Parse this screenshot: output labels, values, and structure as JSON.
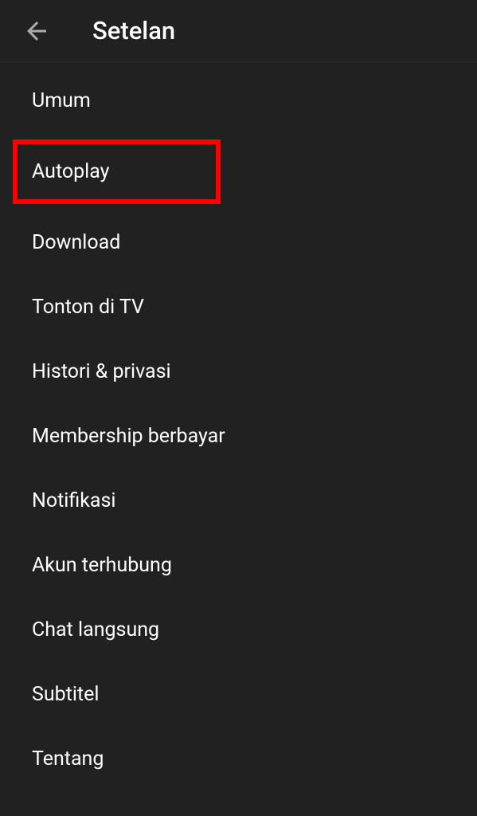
{
  "header": {
    "title": "Setelan"
  },
  "settings": {
    "items": [
      {
        "label": "Umum",
        "highlighted": false
      },
      {
        "label": "Autoplay",
        "highlighted": true
      },
      {
        "label": "Download",
        "highlighted": false
      },
      {
        "label": "Tonton di TV",
        "highlighted": false
      },
      {
        "label": "Histori & privasi",
        "highlighted": false
      },
      {
        "label": "Membership berbayar",
        "highlighted": false
      },
      {
        "label": "Notifikasi",
        "highlighted": false
      },
      {
        "label": "Akun terhubung",
        "highlighted": false
      },
      {
        "label": "Chat langsung",
        "highlighted": false
      },
      {
        "label": "Subtitel",
        "highlighted": false
      },
      {
        "label": "Tentang",
        "highlighted": false
      }
    ]
  }
}
